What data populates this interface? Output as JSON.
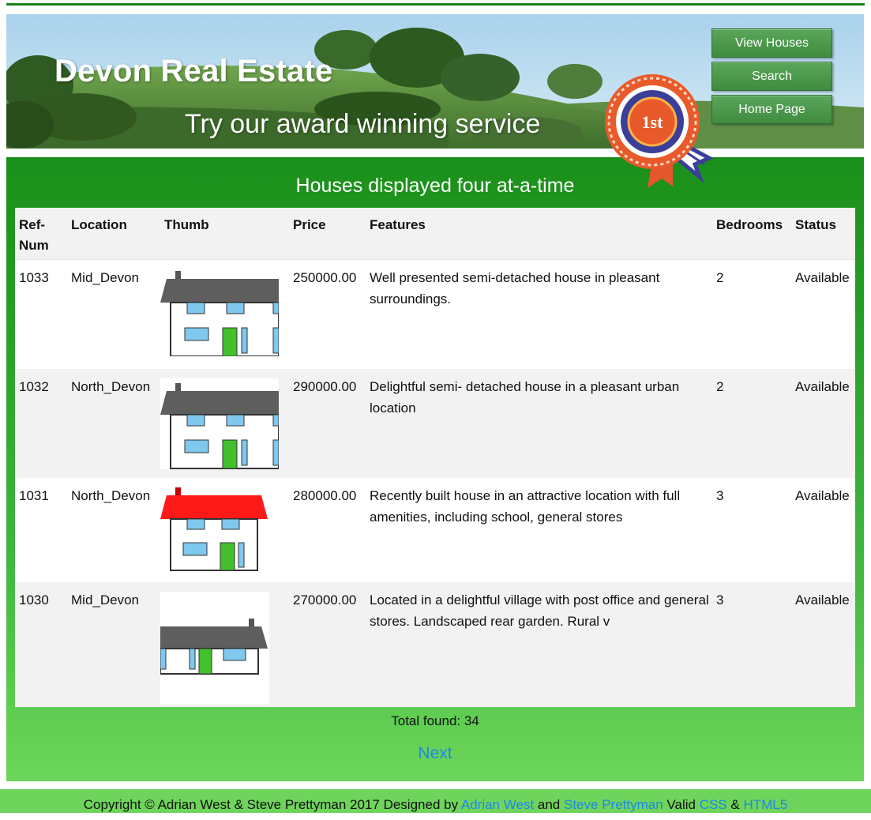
{
  "header": {
    "title": "Devon Real Estate",
    "tagline": "Try our award winning service",
    "rosette_text": "1st",
    "nav": [
      "View Houses",
      "Search",
      "Home Page"
    ]
  },
  "main": {
    "heading": "Houses displayed four at-a-time",
    "columns": [
      "Ref-Num",
      "Location",
      "Thumb",
      "Price",
      "Features",
      "Bedrooms",
      "Status"
    ],
    "rows": [
      {
        "ref": "1033",
        "location": "Mid_Devon",
        "thumb": "grey-roof-house-wide",
        "price": "250000.00",
        "features": "Well presented semi-detached house in pleasant surroundings.",
        "bedrooms": "2",
        "status": "Available"
      },
      {
        "ref": "1032",
        "location": "North_Devon",
        "thumb": "grey-roof-house-wide",
        "price": "290000.00",
        "features": "Delightful semi- detached house in a pleasant urban location",
        "bedrooms": "2",
        "status": "Available"
      },
      {
        "ref": "1031",
        "location": "North_Devon",
        "thumb": "red-roof-house",
        "price": "280000.00",
        "features": "Recently built house in an attractive location with full amenities, including school, general stores",
        "bedrooms": "3",
        "status": "Available"
      },
      {
        "ref": "1030",
        "location": "Mid_Devon",
        "thumb": "bungalow",
        "price": "270000.00",
        "features": "Located in a delightful village with post office and general stores. Landscaped rear garden. Rural v",
        "bedrooms": "3",
        "status": "Available"
      }
    ],
    "total_label": "Total found: 34",
    "next_label": "Next"
  },
  "footer": {
    "prefix": "Copyright © Adrian West & Steve Prettyman 2017 Designed by",
    "author1": "Adrian West",
    "and": "and",
    "author2": "Steve Prettyman",
    "valid": "Valid",
    "css": "CSS",
    "amp": "&",
    "html5": "HTML5"
  },
  "colors": {
    "brand_green": "#1b8f1b",
    "button_green": "#4a9a4a",
    "link_blue": "#1e88e5",
    "footer_green": "#6fd45c"
  }
}
